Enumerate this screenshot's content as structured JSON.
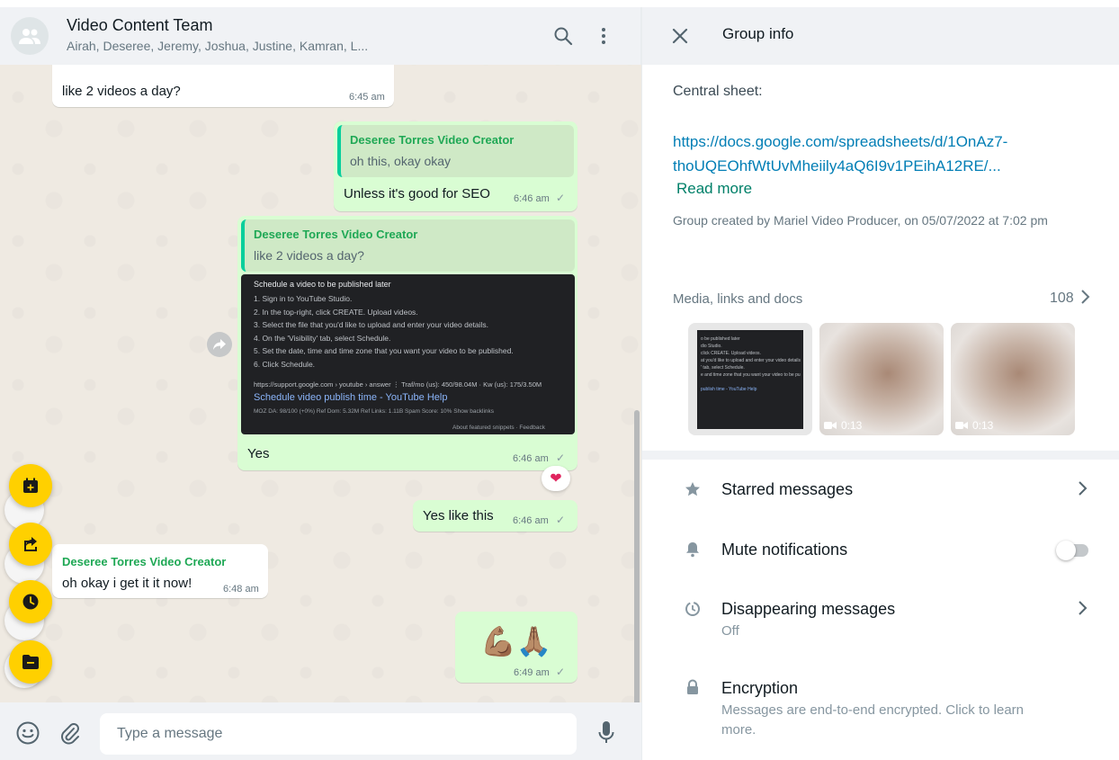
{
  "chat": {
    "title": "Video Content Team",
    "members": "Airah, Deseree, Jeremy, Joshua, Justine, Kamran, L...",
    "messages": [
      {
        "text": "like 2 videos a day?",
        "time": "6:45 am"
      },
      {
        "quote_name": "Deseree Torres Video Creator",
        "quote_text": "oh this, okay okay",
        "text": "Unless it's good for SEO",
        "time": "6:46 am"
      },
      {
        "quote_name": "Deseree Torres Video Creator",
        "quote_text": "like 2 videos a day?",
        "text": "Yes",
        "time": "6:46 am"
      },
      {
        "text": "Yes like this",
        "time": "6:46 am"
      },
      {
        "sender": "Deseree Torres Video Creator",
        "text": "oh okay i get it it now!",
        "time": "6:48 am"
      },
      {
        "text": "💪🏽🙏🏽",
        "time": "6:49 am"
      }
    ],
    "snippet": {
      "title": "Schedule a video to be published later",
      "steps": [
        "1. Sign in to YouTube Studio.",
        "2. In the top-right, click CREATE. Upload videos.",
        "3. Select the file that you'd like to upload and enter your video details.",
        "4. On the 'Visibility' tab, select Schedule.",
        "5. Set the date, time and time zone that you want your video to be published.",
        "6. Click Schedule."
      ],
      "url": "https://support.google.com › youtube › answer      ⋮ Traf/mo (us): 450/98.04M · Kw (us): 175/3.50M",
      "link": "Schedule video publish time - YouTube Help",
      "meta": "MOZ DA: 98/100 (+0%)   Ref Dom: 5.32M   Ref Links: 1.11B   Spam Score: 10%   Show backlinks",
      "footer": "About featured snippets  ·  Feedback"
    },
    "reaction": "❤",
    "input_placeholder": "Type a message"
  },
  "info": {
    "title": "Group info",
    "description_label": "Central sheet:",
    "description_link": "https://docs.google.com/spreadsheets/d/1OnAz7-thoUQEOhfWtUvMheiily4aQ6I9v1PEihA12RE/...",
    "read_more": "Read more",
    "created": "Group created by Mariel Video Producer, on 05/07/2022 at 7:02 pm",
    "media_label": "Media, links and docs",
    "media_count": "108",
    "media": [
      {
        "type": "doc",
        "lines": [
          "o be published later",
          "dio Studio.",
          "click CREATE. Upload videos.",
          "at you'd like to upload and enter your video details",
          "' tab, select Schedule.",
          "e and time zone that you want your video to be pu"
        ],
        "link": "publish time - YouTube Help"
      },
      {
        "type": "video",
        "duration": "0:13"
      },
      {
        "type": "video",
        "duration": "0:13"
      }
    ],
    "rows": {
      "starred": "Starred messages",
      "mute": "Mute notifications",
      "disappearing": "Disappearing messages",
      "disappearing_value": "Off",
      "encryption": "Encryption",
      "encryption_desc": "Messages are end-to-end encrypted. Click to learn more."
    },
    "mute_enabled": false
  },
  "colors": {
    "outgoing_bubble": "#d9fdd3",
    "incoming_bubble": "#ffffff",
    "sender_name": "#1fa855",
    "link": "#027eb5",
    "read_more": "#008069",
    "fab_yellow": "#ffd000"
  }
}
